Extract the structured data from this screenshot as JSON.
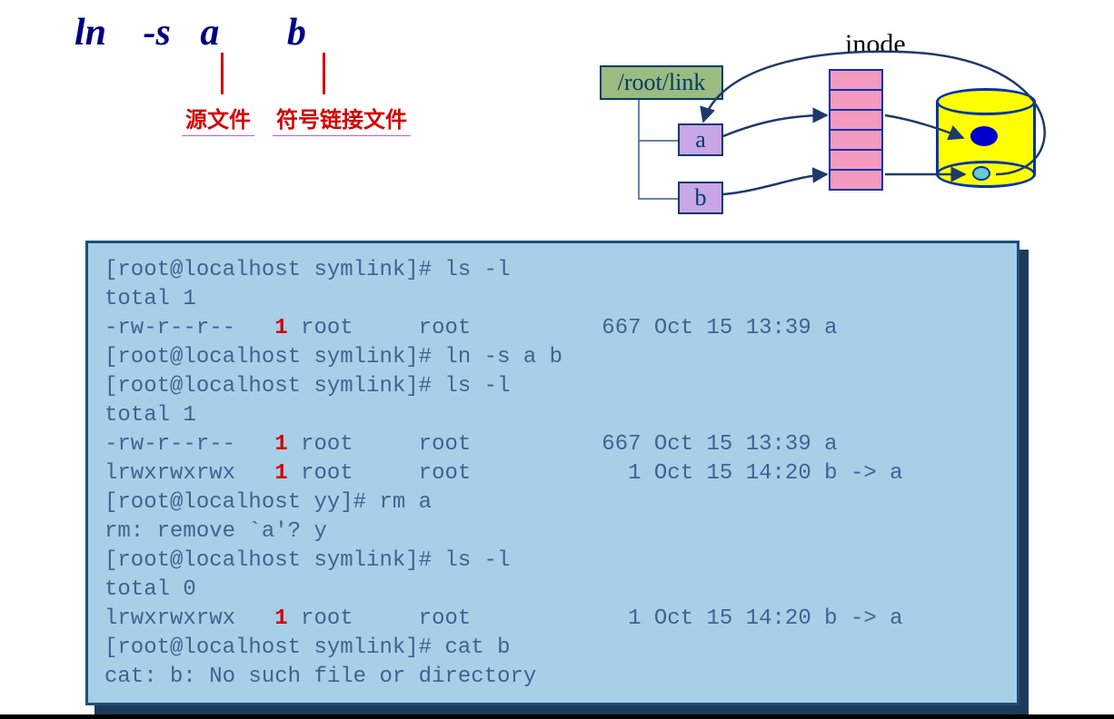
{
  "cmd": {
    "ln": "ln",
    "opt": "-s",
    "a": "a",
    "b": "b"
  },
  "labels": {
    "source": "源文件",
    "symlink": "符号链接文件"
  },
  "diagram": {
    "inode": "inode",
    "root": "/root/link",
    "a": "a",
    "b": "b",
    "cells": 6
  },
  "terminal": {
    "lines": [
      {
        "pre": "[root@localhost symlink]# ls -l"
      },
      {
        "pre": "total 1"
      },
      {
        "pre": "-rw-r--r--   ",
        "one": "1",
        "post": " root     root          667 Oct 15 13:39 a"
      },
      {
        "pre": "[root@localhost symlink]# ln -s a b"
      },
      {
        "pre": "[root@localhost symlink]# ls -l"
      },
      {
        "pre": "total 1"
      },
      {
        "pre": "-rw-r--r--   ",
        "one": "1",
        "post": " root     root          667 Oct 15 13:39 a"
      },
      {
        "pre": "lrwxrwxrwx   ",
        "one": "1",
        "post": " root     root            1 Oct 15 14:20 b -> a"
      },
      {
        "pre": "[root@localhost yy]# rm a"
      },
      {
        "pre": "rm: remove `a'? y"
      },
      {
        "pre": "[root@localhost symlink]# ls -l"
      },
      {
        "pre": "total 0"
      },
      {
        "pre": "lrwxrwxrwx   ",
        "one": "1",
        "post": " root     root            1 Oct 15 14:20 b -> a"
      },
      {
        "pre": "[root@localhost symlink]# cat b"
      },
      {
        "pre": "cat: b: No such file or directory"
      }
    ]
  }
}
